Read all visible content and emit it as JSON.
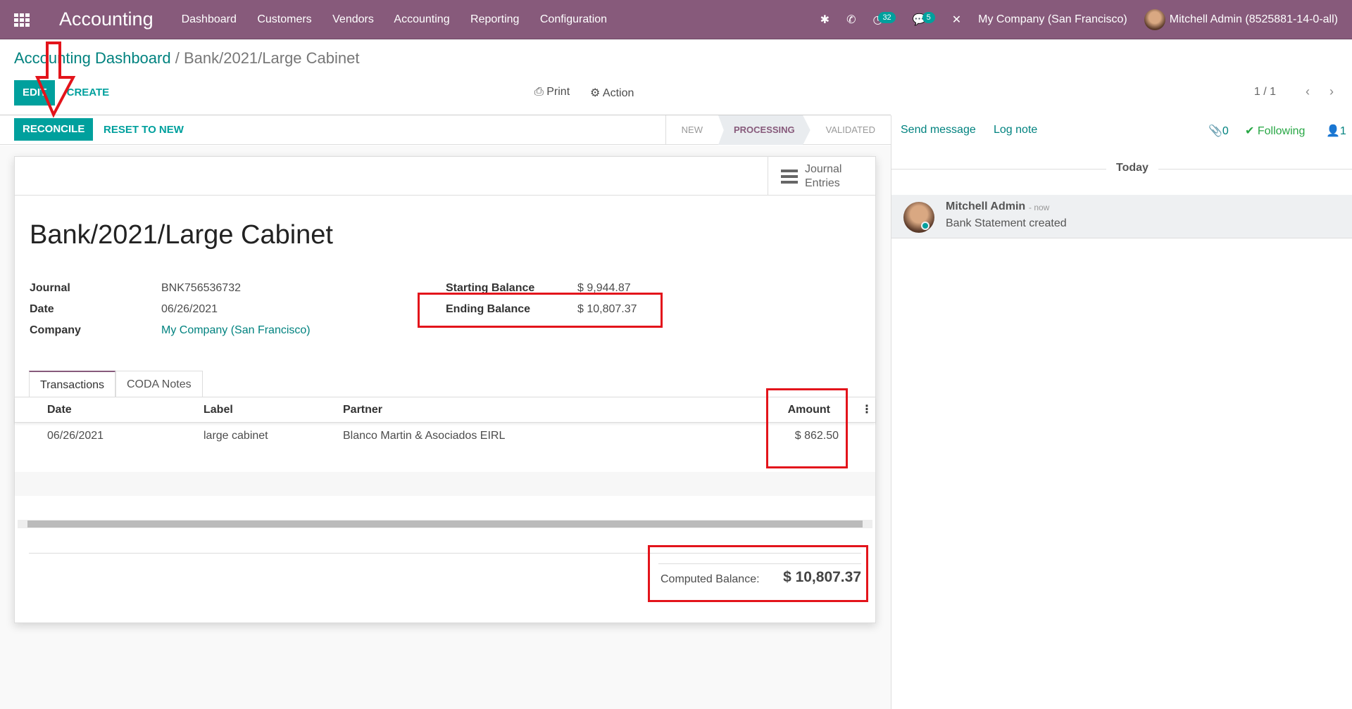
{
  "navbar": {
    "app_title": "Accounting",
    "menu": [
      "Dashboard",
      "Customers",
      "Vendors",
      "Accounting",
      "Reporting",
      "Configuration"
    ],
    "activity_count": "32",
    "message_count": "5",
    "company": "My Company (San Francisco)",
    "user": "Mitchell Admin (8525881-14-0-all)"
  },
  "breadcrumb": {
    "parent": "Accounting Dashboard",
    "separator": "/",
    "current": "Bank/2021/Large Cabinet"
  },
  "toolbar": {
    "edit": "EDIT",
    "create": "CREATE",
    "print": "Print",
    "action": "Action",
    "pager": "1 / 1"
  },
  "statusbar": {
    "reconcile": "RECONCILE",
    "reset": "RESET TO NEW",
    "steps": [
      "NEW",
      "PROCESSING",
      "VALIDATED"
    ],
    "active_step": "PROCESSING"
  },
  "form": {
    "smart_button": {
      "line1": "Journal",
      "line2": "Entries"
    },
    "title": "Bank/2021/Large Cabinet",
    "fields": {
      "journal_label": "Journal",
      "journal": "BNK756536732",
      "date_label": "Date",
      "date": "06/26/2021",
      "company_label": "Company",
      "company": "My Company (San Francisco)",
      "start_label": "Starting Balance",
      "start": "$ 9,944.87",
      "end_label": "Ending Balance",
      "end": "$ 10,807.37"
    },
    "tabs": [
      "Transactions",
      "CODA Notes"
    ],
    "table": {
      "headers": [
        "Date",
        "Label",
        "Partner",
        "Amount"
      ],
      "rows": [
        {
          "date": "06/26/2021",
          "label": "large cabinet",
          "partner": "Blanco Martin & Asociados EIRL",
          "amount": "$ 862.50"
        }
      ]
    },
    "computed_label": "Computed Balance:",
    "computed": "$ 10,807.37"
  },
  "chatter": {
    "send": "Send message",
    "log": "Log note",
    "attachments": "0",
    "following": "Following",
    "followers": "1",
    "today": "Today",
    "message": {
      "author": "Mitchell Admin",
      "time": "- now",
      "body": "Bank Statement created"
    }
  },
  "colors": {
    "brand": "#875a7b",
    "accent": "#00a09d",
    "annotation": "#e3141b"
  }
}
